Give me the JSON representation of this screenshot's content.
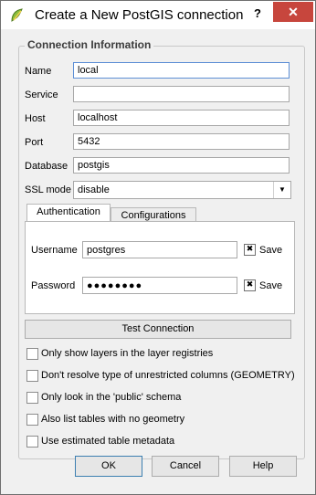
{
  "window": {
    "title": "Create a New PostGIS connection",
    "help_glyph": "?",
    "close_glyph": "✕"
  },
  "group": {
    "title": "Connection Information"
  },
  "form": {
    "name": {
      "label": "Name",
      "value": "local"
    },
    "service": {
      "label": "Service",
      "value": ""
    },
    "host": {
      "label": "Host",
      "value": "localhost"
    },
    "port": {
      "label": "Port",
      "value": "5432"
    },
    "database": {
      "label": "Database",
      "value": "postgis"
    },
    "ssl": {
      "label": "SSL mode",
      "value": "disable"
    }
  },
  "tabs": {
    "authentication": "Authentication",
    "configurations": "Configurations"
  },
  "auth": {
    "username": {
      "label": "Username",
      "value": "postgres",
      "save_label": "Save",
      "save_checked": true
    },
    "password": {
      "label": "Password",
      "value": "●●●●●●●●",
      "save_label": "Save",
      "save_checked": true
    }
  },
  "test_button": "Test Connection",
  "options": [
    {
      "label": "Only show layers in the layer registries",
      "checked": false
    },
    {
      "label": "Don't resolve type of unrestricted columns (GEOMETRY)",
      "checked": false
    },
    {
      "label": "Only look in the 'public' schema",
      "checked": false
    },
    {
      "label": "Also list tables with no geometry",
      "checked": false
    },
    {
      "label": "Use estimated table metadata",
      "checked": false
    }
  ],
  "buttons": {
    "ok": "OK",
    "cancel": "Cancel",
    "help": "Help"
  },
  "colors": {
    "close_bg": "#c7463d",
    "focus_border": "#5d8fd5",
    "dialog_bg": "#f0f0f0"
  }
}
